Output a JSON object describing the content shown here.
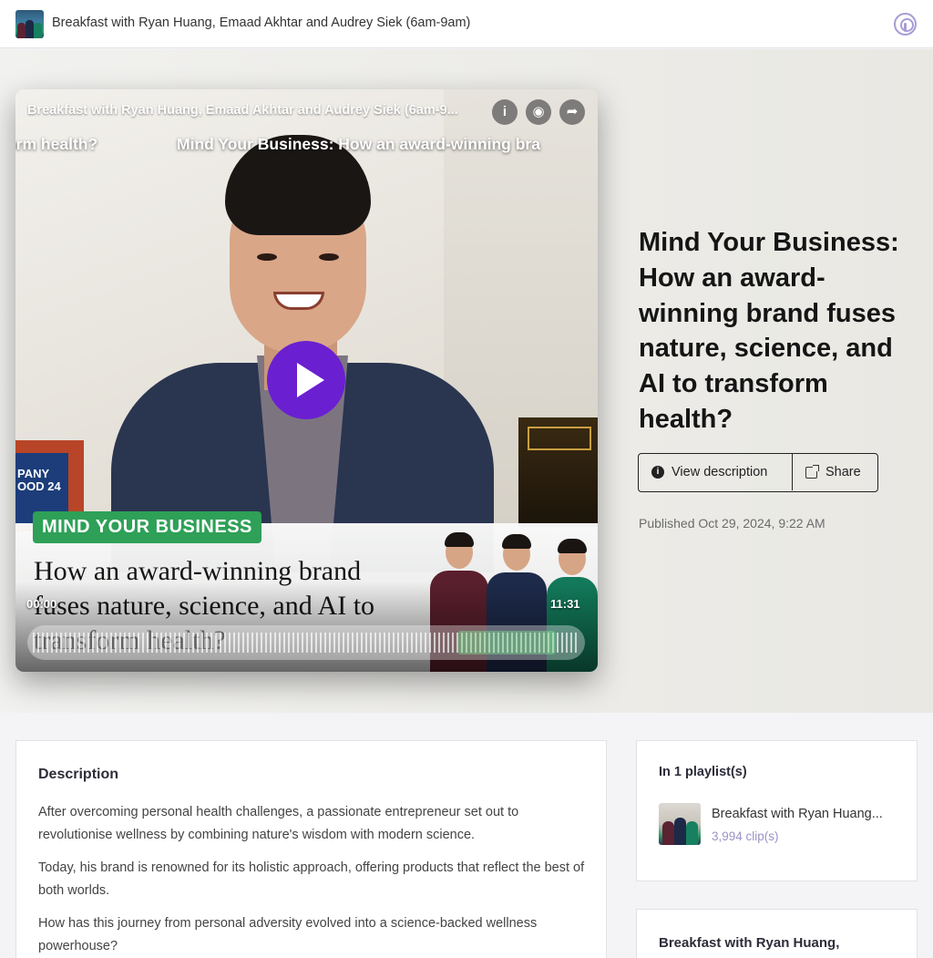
{
  "topbar": {
    "title": "Breakfast with Ryan Huang, Emaad Akhtar and Audrey Siek (6am-9am)",
    "right_icon": "podcast-icon"
  },
  "player": {
    "title": "Breakfast with Ryan Huang, Emaad Akhtar and Audrey Siek (6am-9...",
    "ticker_prev": "orm health?",
    "ticker_current": "Mind Your Business: How an award-winning bra",
    "icons": [
      "info-icon",
      "podcast-icon",
      "share-icon",
      "play-icon"
    ],
    "badge": "MIND YOUR BUSINESS",
    "headline": "How an award-winning brand fuses nature, science, and AI to transform health?",
    "frame_text": "PANY OOD 24",
    "time_elapsed": "00:00",
    "time_total": "11:31",
    "accent_color": "#6a1fd1",
    "badge_color": "#2ea057"
  },
  "episode": {
    "title": "Mind Your Business: How an award-winning brand fuses nature, science, and AI to transform health?",
    "view_description_label": "View description",
    "share_label": "Share",
    "published": "Published Oct 29, 2024, 9:22 AM"
  },
  "description": {
    "heading": "Description",
    "paragraphs": [
      "After overcoming personal health challenges, a passionate entrepreneur set out to revolutionise wellness by combining nature's wisdom with modern science.",
      "Today, his brand is renowned for its holistic approach, offering products that reflect the best of both worlds.",
      "How has this journey from personal adversity evolved into a science-backed wellness powerhouse?"
    ]
  },
  "playlists": {
    "heading": "In 1 playlist(s)",
    "items": [
      {
        "name": "Breakfast with Ryan Huang...",
        "count": "3,994 clip(s)"
      }
    ]
  },
  "show_card": {
    "heading": "Breakfast with Ryan Huang,"
  }
}
